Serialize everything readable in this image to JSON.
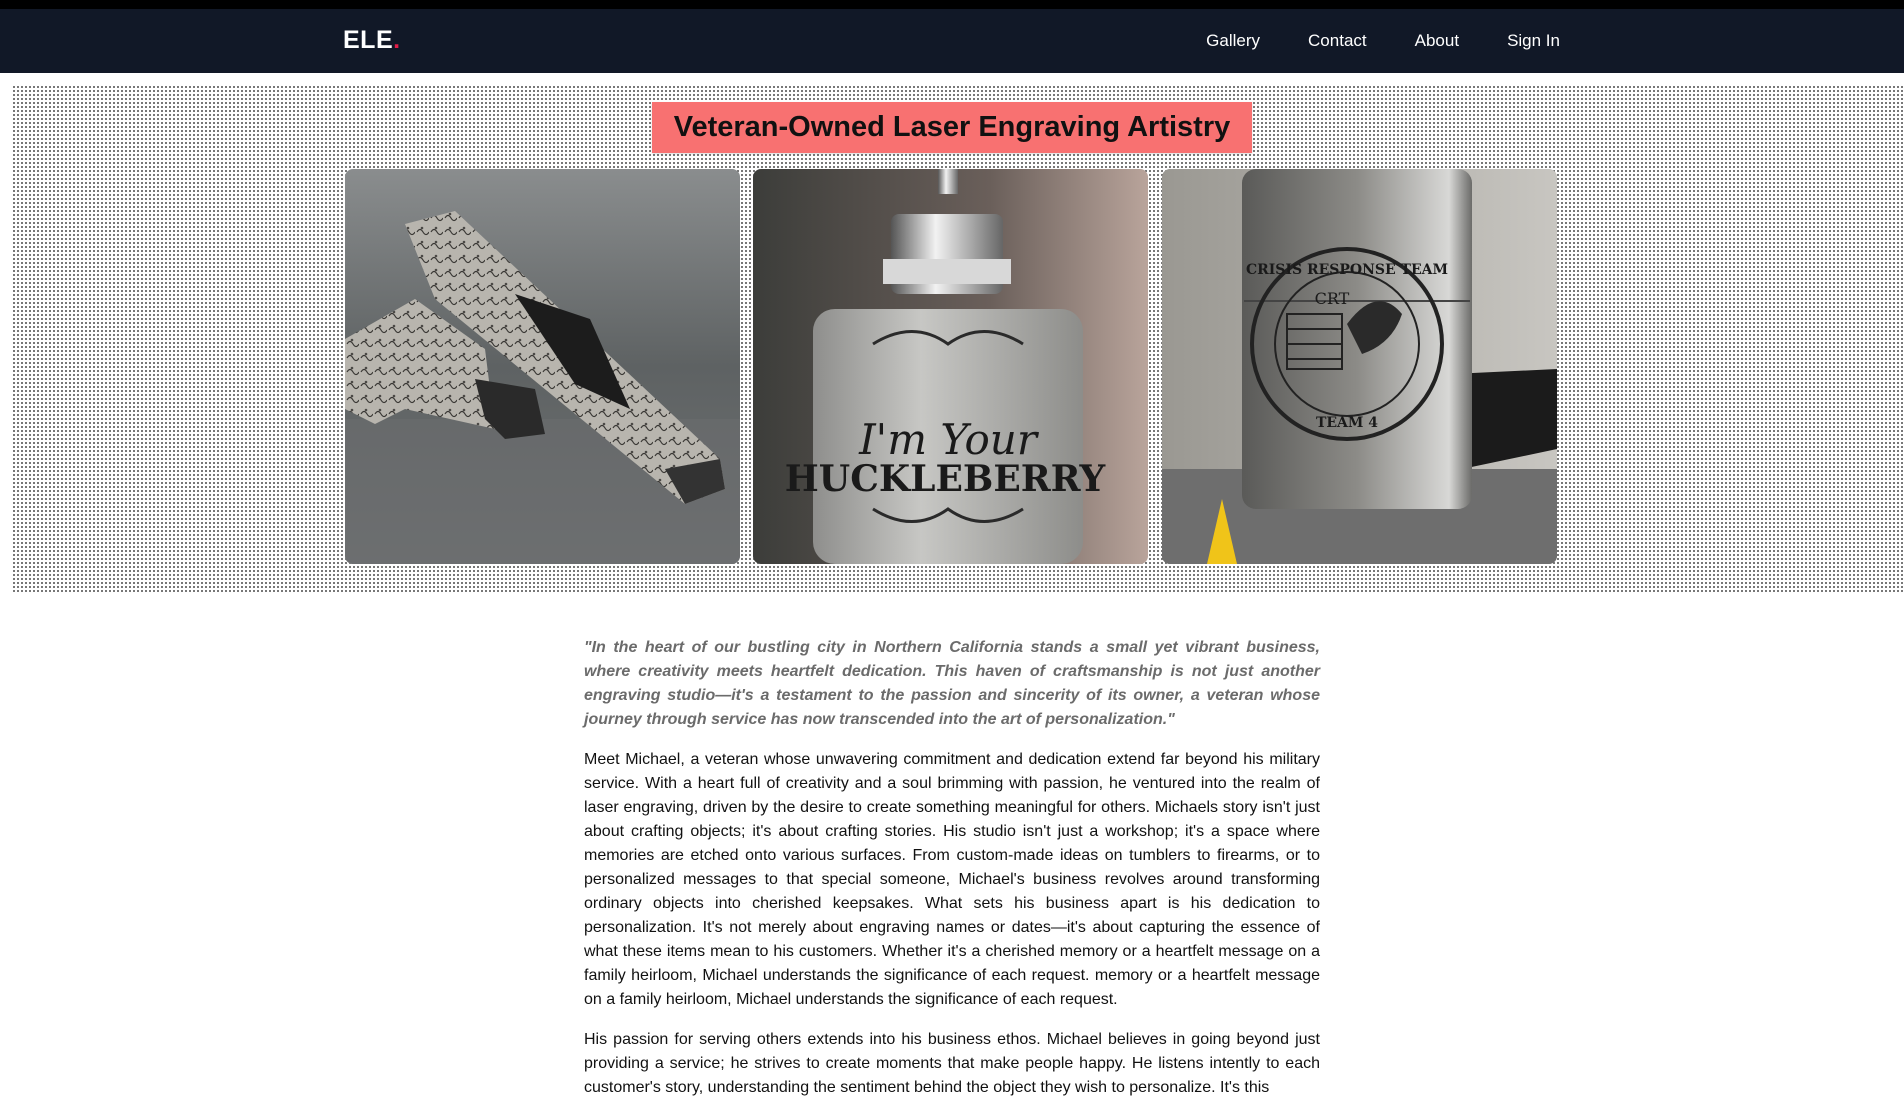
{
  "nav": {
    "logo_text": "ELE",
    "logo_dot": ".",
    "links": [
      "Gallery",
      "Contact",
      "About",
      "Sign In"
    ]
  },
  "hero": {
    "title": "Veteran-Owned Laser Engraving Artistry",
    "images": [
      {
        "name": "engraved-pistol-photo"
      },
      {
        "name": "engraved-flask-keychain-photo",
        "engraving_line1": "I'm Your",
        "engraving_line2": "HUCKLEBERRY"
      },
      {
        "name": "engraved-lighter-photo",
        "engraving_arc": "CRISIS RESPONSE TEAM",
        "engraving_badge": "CRT",
        "engraving_bottom": "TEAM 4"
      }
    ]
  },
  "content": {
    "quote": "\"In the heart of our bustling city in Northern California stands a small yet vibrant business, where creativity meets heartfelt dedication. This haven of craftsmanship is not just another engraving studio—it's a testament to the passion and sincerity of its owner, a veteran whose journey through service has now transcended into the art of personalization.\"",
    "paragraph1": "Meet Michael, a veteran whose unwavering commitment and dedication extend far beyond his military service. With a heart full of creativity and a soul brimming with passion, he ventured into the realm of laser engraving, driven by the desire to create something meaningful for others. Michaels story isn't just about crafting objects; it's about crafting stories. His studio isn't just a workshop; it's a space where memories are etched onto various surfaces. From custom-made ideas on tumblers to firearms, or to personalized messages to that special someone, Michael's business revolves around transforming ordinary objects into cherished keepsakes. What sets his business apart is his dedication to personalization. It's not merely about engraving names or dates—it's about capturing the essence of what these items mean to his customers. Whether it's a cherished memory or a heartfelt message on a family heirloom, Michael understands the significance of each request. memory or a heartfelt message on a family heirloom, Michael understands the significance of each request.",
    "paragraph2": "His passion for serving others extends into his business ethos. Michael believes in going beyond just providing a service; he strives to create moments that make people happy. He listens intently to each customer's story, understanding the sentiment behind the object they wish to personalize. It's this"
  },
  "colors": {
    "navbar_bg": "#111827",
    "title_bg": "#f87171",
    "logo_dot": "#e11d48"
  }
}
